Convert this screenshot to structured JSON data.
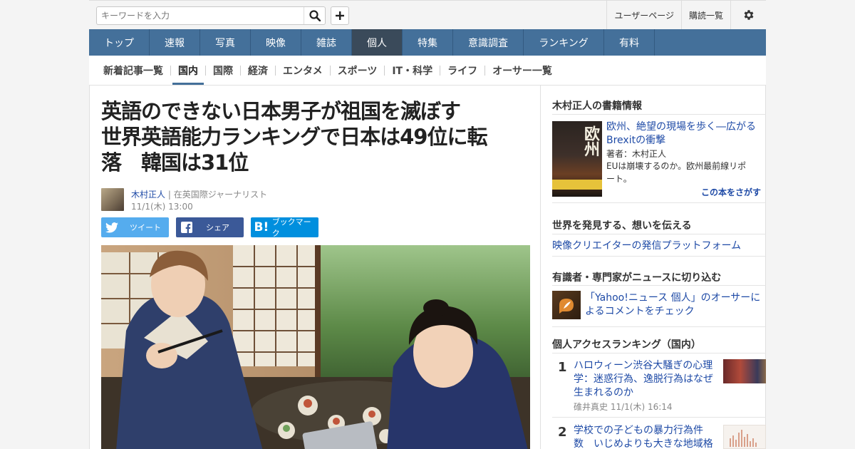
{
  "header": {
    "search_placeholder": "キーワードを入力",
    "links": [
      "ユーザーページ",
      "購読一覧"
    ]
  },
  "global_nav": [
    {
      "label": "トップ",
      "active": false
    },
    {
      "label": "速報",
      "active": false
    },
    {
      "label": "写真",
      "active": false
    },
    {
      "label": "映像",
      "active": false
    },
    {
      "label": "雑誌",
      "active": false
    },
    {
      "label": "個人",
      "active": true
    },
    {
      "label": "特集",
      "active": false
    },
    {
      "label": "意識調査",
      "active": false
    },
    {
      "label": "ランキング",
      "active": false
    },
    {
      "label": "有料",
      "active": false
    }
  ],
  "sub_nav": [
    {
      "label": "新着記事一覧",
      "active": false
    },
    {
      "label": "国内",
      "active": true
    },
    {
      "label": "国際",
      "active": false
    },
    {
      "label": "経済",
      "active": false
    },
    {
      "label": "エンタメ",
      "active": false
    },
    {
      "label": "スポーツ",
      "active": false
    },
    {
      "label": "IT・科学",
      "active": false
    },
    {
      "label": "ライフ",
      "active": false
    },
    {
      "label": "オーサー一覧",
      "active": false
    }
  ],
  "article": {
    "title_lines": [
      "英語のできない日本男子が祖国を滅ぼす",
      "世界英語能力ランキングで日本は49位に転",
      "落　韓国は31位"
    ],
    "author_name": "木村正人",
    "author_role": "| 在英国際ジャーナリスト",
    "date": "11/1(木) 13:00",
    "share": [
      {
        "label": "ツイート",
        "icon": "twitter-icon",
        "color": "#55acee"
      },
      {
        "label": "シェア",
        "icon": "facebook-icon",
        "color": "#3b5998"
      },
      {
        "label": "ブックマーク",
        "icon": "hatena-icon",
        "color": "#008fde"
      }
    ]
  },
  "sidebar": {
    "books": {
      "heading": "木村正人の書籍情報",
      "title_lines": [
        "欧州、絶望の現場を歩く―広がる",
        "Brexitの衝撃"
      ],
      "author": "著者：木村正人",
      "desc_lines": [
        "EUは崩壊するのか。欧州最前線リポ",
        "ート。"
      ],
      "more": "この本をさがす",
      "cover_text": "欧州"
    },
    "promo1": {
      "heading": "世界を発見する、想いを伝える",
      "link": "映像クリエイターの発信プラットフォーム"
    },
    "promo2": {
      "heading": "有識者・専門家がニュースに切り込む",
      "link_lines": [
        "「Yahoo!ニュース 個人」のオーサーに",
        "よるコメントをチェック"
      ]
    },
    "ranking": {
      "heading": "個人アクセスランキング（国内）",
      "items": [
        {
          "rank": "1",
          "title_lines": [
            "ハロウィーン渋谷大騒ぎの心理",
            "学：迷惑行為、逸脱行為はなぜ",
            "生まれるのか"
          ],
          "meta": "碓井真史  11/1(木) 16:14"
        },
        {
          "rank": "2",
          "title_lines": [
            "学校での子どもの暴力行為件",
            "数　いじめよりも大きな地域格"
          ],
          "meta": ""
        }
      ]
    }
  }
}
